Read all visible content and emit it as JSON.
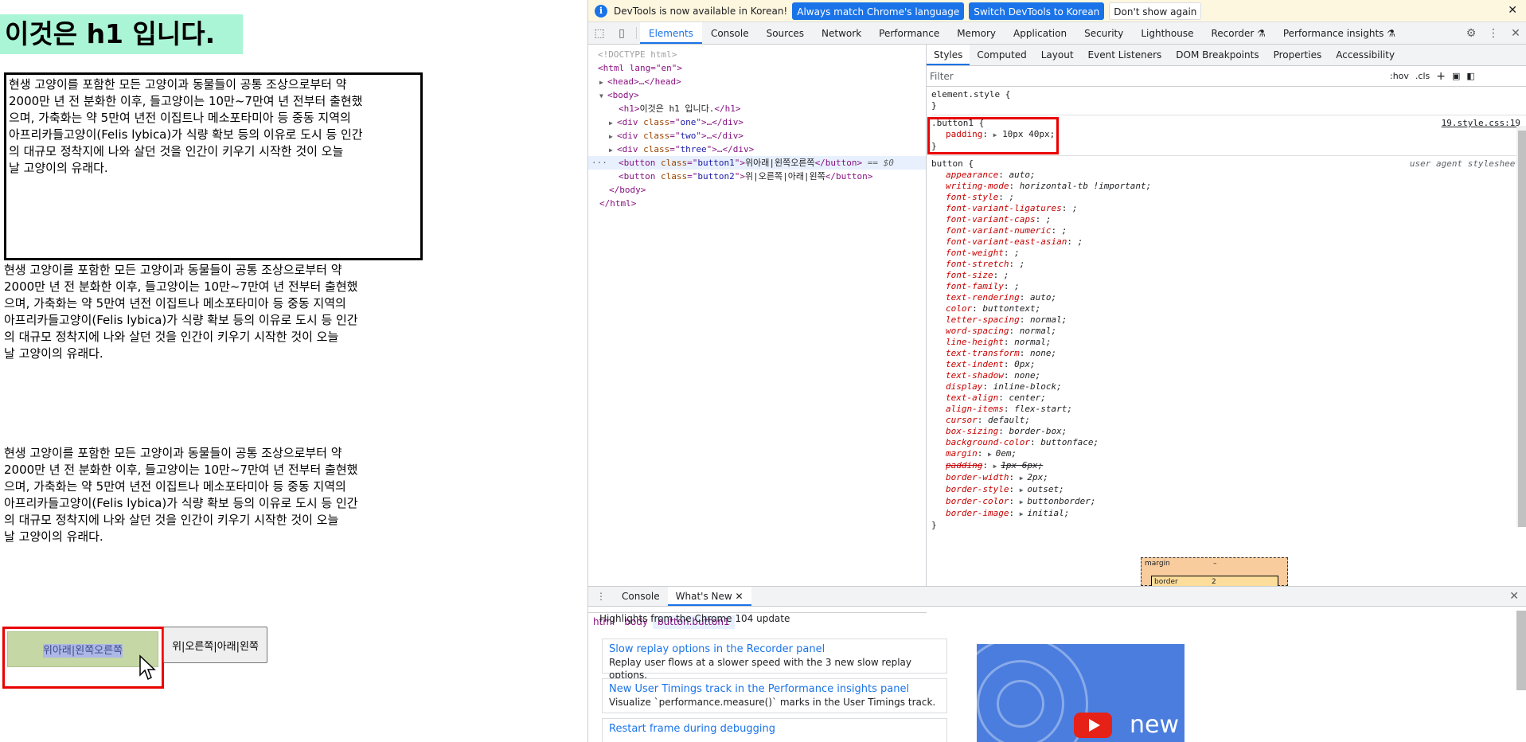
{
  "page": {
    "h1": "이것은 h1 입니다.",
    "paragraph_lines": [
      "현생 고양이를 포함한 모든 고양이과 동물들이 공통 조상으로부터 약",
      "2000만 년 전 분화한 이후, 들고양이는 10만~7만여 년 전부터 출현했",
      "으며, 가축화는 약 5만여 년전 이집트나 메소포타미아 등 중동 지역의",
      "아프리카들고양이(Felis lybica)가 식량 확보 등의 이유로 도시 등 인간",
      "의 대규모 정착지에 나와 살던 것을 인간이 키우기 시작한 것이 오늘",
      "날 고양이의 유래다."
    ],
    "button1": "위아래|왼쪽오른쪽",
    "button2": "위|오른쪽|아래|왼쪽"
  },
  "devtools": {
    "infobar": {
      "text": "DevTools is now available in Korean!",
      "btn_match": "Always match Chrome's language",
      "btn_switch": "Switch DevTools to Korean",
      "btn_dismiss": "Don't show again"
    },
    "tabs": [
      "Elements",
      "Console",
      "Sources",
      "Network",
      "Performance",
      "Memory",
      "Application",
      "Security",
      "Lighthouse",
      "Recorder ⚗",
      "Performance insights ⚗"
    ],
    "dom": {
      "doctype": "<!DOCTYPE html>",
      "html_open": "<html lang=\"en\">",
      "head": "<head>…</head>",
      "body_open": "<body>",
      "h1_text": "이것은 h1 입니다.",
      "div_one": "one",
      "div_two": "two",
      "div_three": "three",
      "button1_class": "button1",
      "button1_text": "위아래|왼쪽오른쪽",
      "button2_class": "button2",
      "button2_text": "위|오른쪽|아래|왼쪽",
      "eq0": "== $0",
      "body_close": "</body>",
      "html_close": "</html>"
    },
    "breadcrumb": [
      "html",
      "body",
      "button.button1"
    ],
    "style_tabs": [
      "Styles",
      "Computed",
      "Layout",
      "Event Listeners",
      "DOM Breakpoints",
      "Properties",
      "Accessibility"
    ],
    "filter_placeholder": "Filter",
    "filter_tools": [
      ":hov",
      ".cls",
      "+"
    ],
    "rules": {
      "element_style": "element.style {",
      "button1_selector": ".button1 {",
      "button1_source": "19.style.css:19",
      "button1_decl_name": "padding",
      "button1_decl_value": "10px 40px;",
      "ua_selector": "button {",
      "ua_source": "user agent stylesheet",
      "ua_decls": [
        {
          "name": "appearance",
          "value": "auto;"
        },
        {
          "name": "writing-mode",
          "value": "horizontal-tb !important;"
        },
        {
          "name": "font-style",
          "value": ";"
        },
        {
          "name": "font-variant-ligatures",
          "value": ";"
        },
        {
          "name": "font-variant-caps",
          "value": ";"
        },
        {
          "name": "font-variant-numeric",
          "value": ";"
        },
        {
          "name": "font-variant-east-asian",
          "value": ";"
        },
        {
          "name": "font-weight",
          "value": ";"
        },
        {
          "name": "font-stretch",
          "value": ";"
        },
        {
          "name": "font-size",
          "value": ";"
        },
        {
          "name": "font-family",
          "value": ";"
        },
        {
          "name": "text-rendering",
          "value": "auto;"
        },
        {
          "name": "color",
          "value": "buttontext;"
        },
        {
          "name": "letter-spacing",
          "value": "normal;"
        },
        {
          "name": "word-spacing",
          "value": "normal;"
        },
        {
          "name": "line-height",
          "value": "normal;"
        },
        {
          "name": "text-transform",
          "value": "none;"
        },
        {
          "name": "text-indent",
          "value": "0px;"
        },
        {
          "name": "text-shadow",
          "value": "none;"
        },
        {
          "name": "display",
          "value": "inline-block;"
        },
        {
          "name": "text-align",
          "value": "center;"
        },
        {
          "name": "align-items",
          "value": "flex-start;"
        },
        {
          "name": "cursor",
          "value": "default;"
        },
        {
          "name": "box-sizing",
          "value": "border-box;"
        },
        {
          "name": "background-color",
          "value": "buttonface;"
        },
        {
          "name": "margin",
          "value": "0em;",
          "expand": true
        },
        {
          "name": "padding",
          "value": "1px 6px;",
          "expand": true,
          "struck": true
        },
        {
          "name": "border-width",
          "value": "2px;",
          "expand": true
        },
        {
          "name": "border-style",
          "value": "outset;",
          "expand": true
        },
        {
          "name": "border-color",
          "value": "buttonborder;",
          "expand": true
        },
        {
          "name": "border-image",
          "value": "initial;",
          "expand": true
        }
      ],
      "close_brace": "}"
    },
    "boxmodel": {
      "margin_label": "margin",
      "margin_value": "–",
      "border_label": "border",
      "border_value": "2"
    },
    "drawer": {
      "tabs": [
        "Console",
        "What's New"
      ],
      "heading": "Highlights from the Chrome 104 update",
      "cards": [
        {
          "title": "Slow replay options in the Recorder panel",
          "desc": "Replay user flows at a slower speed with the 3 new slow replay options."
        },
        {
          "title": "New User Timings track in the Performance insights panel",
          "desc": "Visualize `performance.measure()` marks in the User Timings track."
        },
        {
          "title": "Restart frame during debugging",
          "desc": ""
        }
      ],
      "video_text": "new"
    },
    "colors": {
      "accent": "#1a73e8",
      "highlight_red": "#ea0000",
      "h1_bg": "#aaf5d6",
      "button1_bg": "#c5d7a4"
    }
  }
}
